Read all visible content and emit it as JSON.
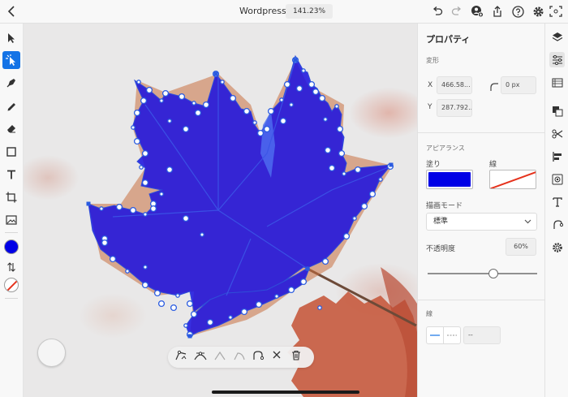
{
  "app": {
    "document_title": "Wordpress",
    "zoom": "141.23%"
  },
  "top_bar": {
    "icons": [
      "back-icon",
      "undo-icon",
      "redo-icon",
      "add-user-icon",
      "share-icon",
      "help-icon",
      "gear-icon",
      "screen-mode-icon"
    ]
  },
  "left_toolbar": {
    "tools": [
      "select-tool",
      "direct-select-tool",
      "pen-tool",
      "pencil-tool",
      "eraser-tool",
      "shape-tool",
      "text-tool",
      "crop-tool",
      "image-tool"
    ],
    "active_tool": "direct-select-tool",
    "fill_color": "#0000e6",
    "stroke_color": "none"
  },
  "path_toolbar": {
    "icons": [
      "anchor-convert-icon",
      "anchor-smooth-icon",
      "anchor-corner-icon",
      "anchor-cusp-icon",
      "join-path-icon",
      "cut-path-icon",
      "delete-icon"
    ]
  },
  "panel": {
    "title": "プロパティ",
    "transform": {
      "section": "変形",
      "x_label": "X",
      "x_value": "466.58...",
      "y_label": "Y",
      "y_value": "287.792...",
      "corner_value": "0 px"
    },
    "appearance": {
      "section": "アピアランス",
      "fill_label": "塗り",
      "stroke_label": "線",
      "fill_color": "#0000e6",
      "blend_label": "描画モード",
      "blend_value": "標準",
      "opacity_label": "不透明度",
      "opacity_value": "60%",
      "opacity_level": 0.6
    },
    "stroke": {
      "section": "線",
      "weight_value": "--"
    }
  },
  "right_rail": {
    "icons": [
      "layers-icon",
      "properties-icon",
      "character-style-icon",
      "arrange-icon",
      "scissors-icon",
      "align-icon",
      "export-icon",
      "text-icon",
      "repeat-icon",
      "settings-icon"
    ],
    "active_icon": "properties-icon"
  },
  "colors": {
    "accent": "#1473e6",
    "leaf_fill": "#1a10e0",
    "stroke_red": "#e5321c"
  }
}
